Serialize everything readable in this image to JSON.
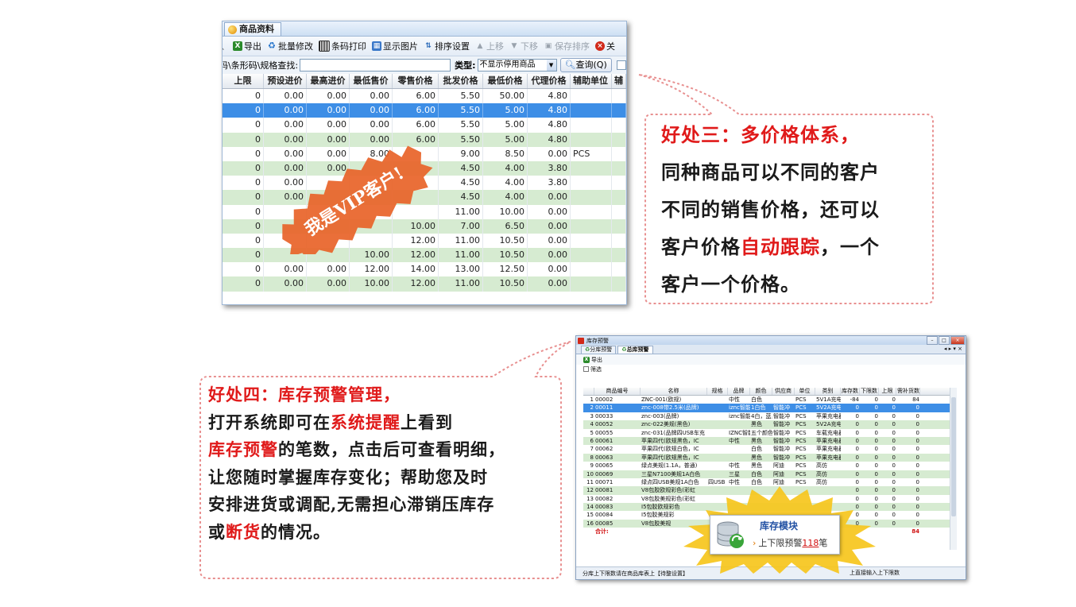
{
  "top_window": {
    "tab_label": "商品资料",
    "toolbar": {
      "export": "导出",
      "batch_edit": "批量修改",
      "barcode_print": "条码打印",
      "show_image": "显示图片",
      "sort_settings": "排序设置",
      "move_up": "上移",
      "move_down": "下移",
      "save_sort": "保存排序",
      "close": "关"
    },
    "search": {
      "label": "码\\条形码\\规格查找:",
      "value": "",
      "type_label": "类型:",
      "type_value": "不显示停用商品",
      "query_button": "查询(Q)"
    },
    "columns": [
      "上限",
      "预设进价",
      "最高进价",
      "最低售价",
      "零售价格",
      "批发价格",
      "最低价格",
      "代理价格",
      "辅助单位",
      "辅"
    ],
    "rows": [
      {
        "style": "white",
        "cells": [
          "0",
          "0.00",
          "0.00",
          "0.00",
          "6.00",
          "5.50",
          "50.00",
          "4.80",
          "",
          ""
        ]
      },
      {
        "style": "sel",
        "cells": [
          "0",
          "0.00",
          "0.00",
          "0.00",
          "6.00",
          "5.50",
          "5.00",
          "4.80",
          "",
          ""
        ]
      },
      {
        "style": "white",
        "cells": [
          "0",
          "0.00",
          "0.00",
          "0.00",
          "6.00",
          "5.50",
          "5.00",
          "4.80",
          "",
          ""
        ]
      },
      {
        "style": "green",
        "cells": [
          "0",
          "0.00",
          "0.00",
          "0.00",
          "6.00",
          "5.50",
          "5.00",
          "4.80",
          "",
          ""
        ]
      },
      {
        "style": "white",
        "cells": [
          "0",
          "0.00",
          "0.00",
          "8.00",
          "",
          "9.00",
          "8.50",
          "0.00",
          "PCS",
          ""
        ]
      },
      {
        "style": "green",
        "cells": [
          "0",
          "0.00",
          "0.00",
          "",
          "",
          "4.50",
          "4.00",
          "3.80",
          "",
          ""
        ]
      },
      {
        "style": "white",
        "cells": [
          "0",
          "0.00",
          "",
          "",
          "",
          "4.50",
          "4.00",
          "3.80",
          "",
          ""
        ]
      },
      {
        "style": "green",
        "cells": [
          "0",
          "0.00",
          "",
          "",
          "",
          "4.50",
          "4.00",
          "0.00",
          "",
          ""
        ]
      },
      {
        "style": "white",
        "cells": [
          "0",
          "",
          "",
          "",
          "",
          "11.00",
          "10.00",
          "0.00",
          "",
          ""
        ]
      },
      {
        "style": "green",
        "cells": [
          "0",
          "",
          "",
          "",
          "10.00",
          "7.00",
          "6.50",
          "0.00",
          "",
          ""
        ]
      },
      {
        "style": "white",
        "cells": [
          "0",
          "",
          "",
          "",
          "12.00",
          "11.00",
          "10.50",
          "0.00",
          "",
          ""
        ]
      },
      {
        "style": "green",
        "cells": [
          "0",
          "",
          "",
          "10.00",
          "12.00",
          "11.00",
          "10.50",
          "0.00",
          "",
          ""
        ]
      },
      {
        "style": "white",
        "cells": [
          "0",
          "0.00",
          "0.00",
          "12.00",
          "14.00",
          "13.00",
          "12.50",
          "0.00",
          "",
          ""
        ]
      },
      {
        "style": "green",
        "cells": [
          "0",
          "0.00",
          "0.00",
          "10.00",
          "12.00",
          "11.00",
          "10.50",
          "0.00",
          "",
          ""
        ]
      }
    ],
    "vip_badge": "我是VIP客户!"
  },
  "callout1": {
    "title": "好处三：多价格体系，",
    "line1": "同种商品可以不同的客户",
    "line2": "不同的销售价格，还可以",
    "line3_a": "客户价格",
    "line3_b": "自动跟踪",
    "line3_c": "，一个",
    "line4": "客户一个价格。"
  },
  "callout2": {
    "title": "好处四：库存预警管理，",
    "line1_a": "打开系统即可在",
    "line1_b": "系统提醒",
    "line1_c": "上看到",
    "line2_a": "库存预警",
    "line2_b": "的笔数，点击后可查看明细，",
    "line3": "让您随时掌握库存变化；帮助您及时",
    "line4": "安排进货或调配,无需担心滞销压库存",
    "line5_a": "或",
    "line5_b": "断货",
    "line5_c": "的情况。"
  },
  "bottom_window": {
    "title": "库存预警",
    "tabs": [
      "分库预警",
      "总库预警"
    ],
    "tab_nav": "◂ ▸ ▾ ×",
    "export": "导出",
    "filter": "筛选",
    "columns": [
      "",
      "商品编号",
      "名称",
      "规格",
      "品牌",
      "颜色",
      "供应商",
      "单位",
      "类别",
      "库存数",
      "下限数",
      "上限",
      "需补货数"
    ],
    "rows": [
      {
        "style": "white",
        "cells": [
          "1",
          "00002",
          "ZNC-001(欧规)",
          "",
          "中性",
          "白色",
          "",
          "PCS",
          "5V1A充电器",
          "-84",
          "0",
          "0",
          "84"
        ]
      },
      {
        "style": "sel",
        "cells": [
          "2",
          "00011",
          "znc-008带2.5米(品牌)",
          "",
          "iznc智能",
          "1白色",
          "智能冲",
          "PCS",
          "5V2A充电器",
          "0",
          "0",
          "0",
          "0"
        ]
      },
      {
        "style": "white",
        "cells": [
          "3",
          "00033",
          "znc-003(品牌)",
          "",
          "iznc智能",
          "4白，蓝，",
          "智能冲",
          "PCS",
          "苹果充电器",
          "0",
          "0",
          "0",
          "0"
        ]
      },
      {
        "style": "green",
        "cells": [
          "4",
          "00052",
          "znc-022美规(黑色)",
          "",
          "",
          "黑色",
          "智能冲",
          "PCS",
          "5V2A充电器",
          "0",
          "0",
          "0",
          "0"
        ]
      },
      {
        "style": "white",
        "cells": [
          "5",
          "00055",
          "znc-031(品牌四USB车充",
          "",
          "IZNC智能",
          "五个颜色",
          "智能冲",
          "PCS",
          "车载充电器",
          "0",
          "0",
          "0",
          "0"
        ]
      },
      {
        "style": "green",
        "cells": [
          "6",
          "00061",
          "苹果四代(欧规黑色，IC",
          "",
          "中性",
          "黑色",
          "智能冲",
          "PCS",
          "苹果充电器",
          "0",
          "0",
          "0",
          "0"
        ]
      },
      {
        "style": "white",
        "cells": [
          "7",
          "00062",
          "苹果四代(欧规白色，IC",
          "",
          "",
          "白色",
          "智能冲",
          "PCS",
          "苹果充电器",
          "0",
          "0",
          "0",
          "0"
        ]
      },
      {
        "style": "green",
        "cells": [
          "8",
          "00063",
          "苹果四代(欧规黑色，IC",
          "",
          "",
          "黑色",
          "智能冲",
          "PCS",
          "苹果充电器",
          "0",
          "0",
          "0",
          "0"
        ]
      },
      {
        "style": "white",
        "cells": [
          "9",
          "00065",
          "绿点美规(1.1A，普通)",
          "",
          "中性",
          "黑色",
          "阿迪",
          "PCS",
          "高仿",
          "0",
          "0",
          "0",
          "0"
        ]
      },
      {
        "style": "green",
        "cells": [
          "10",
          "00069",
          "三星N7100美规1A白色",
          "",
          "三星",
          "白色",
          "阿迪",
          "PCS",
          "高仿",
          "0",
          "0",
          "0",
          "0"
        ]
      },
      {
        "style": "white",
        "cells": [
          "11",
          "00071",
          "绿点四USB美规1A白色",
          "四USB",
          "中性",
          "白色",
          "阿迪",
          "PCS",
          "高仿",
          "0",
          "0",
          "0",
          "0"
        ]
      },
      {
        "style": "green",
        "cells": [
          "12",
          "00081",
          "V8包胶欧规彩色(彩虹",
          "",
          "",
          "",
          "",
          "",
          "",
          "0",
          "0",
          "0",
          "0"
        ]
      },
      {
        "style": "white",
        "cells": [
          "13",
          "00082",
          "V8包胶美规彩色(彩虹",
          "",
          "",
          "",
          "",
          "",
          "",
          "0",
          "0",
          "0",
          "0"
        ]
      },
      {
        "style": "green",
        "cells": [
          "14",
          "00083",
          "I5包胶欧规彩色",
          "",
          "",
          "",
          "",
          "",
          "",
          "0",
          "0",
          "0",
          "0"
        ]
      },
      {
        "style": "white",
        "cells": [
          "15",
          "00084",
          "I5包胶美规彩",
          "",
          "",
          "",
          "",
          "",
          "",
          "0",
          "0",
          "0",
          "0"
        ]
      },
      {
        "style": "green",
        "cells": [
          "16",
          "00085",
          "V8包胶美规",
          "",
          "",
          "",
          "",
          "",
          "",
          "0",
          "0",
          "0",
          "0"
        ]
      },
      {
        "style": "total",
        "cells": [
          "",
          "合计:",
          "",
          "",
          "",
          "",
          "",
          "",
          "",
          "",
          "",
          "",
          "84"
        ]
      }
    ],
    "status_left": "分库上下限数请在商品库表上【待整设置】",
    "status_right": "上直接输入上下限数"
  },
  "popup": {
    "title": "库存模块",
    "caret": "›",
    "text": "上下限预警",
    "count": "118",
    "unit": "笔"
  },
  "colors": {
    "highlight_red": "#e01a1a",
    "grid_green": "#d6ebd1",
    "selection_blue": "#3d8ee6",
    "callout_border": "#e89090",
    "vip_badge": "#e8642a",
    "starburst": "#f6c51c"
  }
}
